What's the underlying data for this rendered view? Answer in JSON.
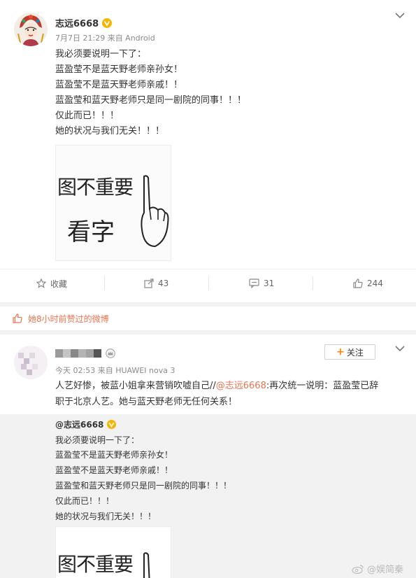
{
  "post1": {
    "username": "志远6668",
    "meta": "7月7日 21:29 来自 Android",
    "lines": [
      "我必须要说明一下了：",
      "蓝盈莹不是蓝天野老师亲孙女！",
      "蓝盈莹不是蓝天野老师亲戚！！",
      "蓝盈莹和蓝天野老师只是同一剧院的同事！！！",
      "仅此而已！！！",
      "她的状况与我们无关！！！"
    ],
    "image_text_top": "图不重要",
    "image_text_bottom": "看字",
    "actions": {
      "favorite_label": "收藏",
      "repost_count": "43",
      "comment_count": "31",
      "like_count": "244"
    }
  },
  "liked_strip": {
    "text": "她8小时前赞过的微博"
  },
  "post2": {
    "username": "",
    "meta": "今天 02:53 来自 HUAWEI nova 3",
    "follow_label": "关注",
    "text_line1_prefix": "人艺好惨，被蓝小姐拿来营销吹嘘自己//",
    "text_line1_mention": "@志远6668",
    "text_line1_suffix": ":再次统一说明：蓝盈莹已辞",
    "text_line2": "职于北京人艺。她与蓝天野老师无任何关系！"
  },
  "repost": {
    "username": "@志远6668",
    "lines": [
      "我必须要说明一下了：",
      "蓝盈莹不是蓝天野老师亲孙女！",
      "蓝盈莹不是蓝天野老师亲戚！！",
      "蓝盈莹和蓝天野老师只是同一剧院的同事！！！",
      "仅此而已！！！",
      "她的状况与我们无关！！！"
    ],
    "image_text_top": "图不重要"
  },
  "watermark": {
    "text": "@娱简秦"
  },
  "colors": {
    "accent": "#eb7350",
    "follow_plus": "#ff8200",
    "verified": "#f7b500"
  }
}
